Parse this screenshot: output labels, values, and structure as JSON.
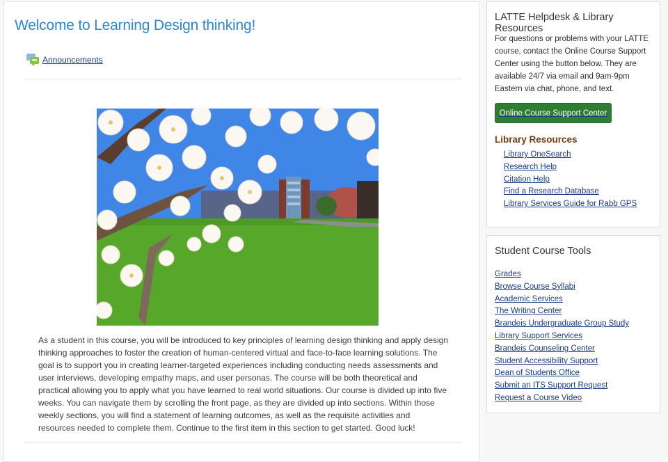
{
  "course": {
    "title": "Welcome to Learning Design thinking!",
    "announcements_link": "Announcements",
    "hero_image_alt": "Magnolia blossoms framing a green campus lawn with buildings under a blue sky",
    "description": "As a student in this course, you will be introduced to key principles of learning design thinking and apply design thinking approaches to foster the creation of human-centered virtual and face-to-face learning solutions. The goal is to support you in creating learner-targeted experiences including conducting needs assessments and user interviews, developing empathy maps, and user personas. The course will be both theoretical and practical allowing you to apply what you have learned to real world situations. Our course is divided up into five weeks. You can navigate them by scrolling the front page, as they are divided up into sections. Within those weekly sections, you will find a statement of learning outcomes, as well as the requisite activities and resources needed to complete them. Continue to the first item in this section to get started. Good luck!"
  },
  "helpdesk": {
    "title": "LATTE Helpdesk & Library Resources",
    "text": "For questions or problems with your LATTE course, contact the Online Course Support Center using the button below. They are available 24/7 via email and 9am-9pm Eastern via chat, phone, and text.",
    "button_label": "Online Course Support Center",
    "library_heading": "Library Resources",
    "library_links": [
      "Library OneSearch",
      "Research Help",
      "Citation Help",
      "Find a Research Database",
      "Library Services Guide for Rabb GPS"
    ]
  },
  "tools": {
    "title": "Student Course Tools",
    "links": [
      "Grades",
      "Browse Course Syllabi",
      "Academic Services",
      "The Writing Center",
      "Brandeis Undergraduate Group Study",
      "Library Support Services",
      "Brandeis Counseling Center",
      "Student Accessibility Support",
      "Dean of Students Office",
      "Submit an ITS Support Request",
      "Request a Course Video"
    ]
  },
  "colors": {
    "title_blue": "#2f86d6",
    "link_blue": "#1b3b86",
    "button_green": "#2e7d32",
    "library_heading_brown": "#7a3b12"
  }
}
